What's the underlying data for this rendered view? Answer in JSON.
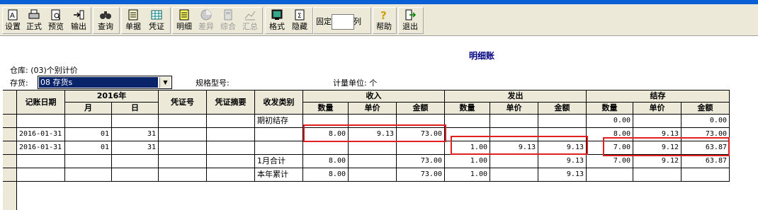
{
  "toolbar": {
    "buttons": [
      {
        "label": "设置",
        "icon": "settings-icon"
      },
      {
        "label": "正式",
        "icon": "print-icon"
      },
      {
        "label": "预览",
        "icon": "preview-icon"
      },
      {
        "label": "输出",
        "icon": "export-icon"
      },
      {
        "label": "查询",
        "icon": "binoculars-icon"
      },
      {
        "label": "单据",
        "icon": "document-icon"
      },
      {
        "label": "凭证",
        "icon": "voucher-icon"
      },
      {
        "label": "明细",
        "icon": "detail-icon"
      },
      {
        "label": "差异",
        "icon": "difference-icon"
      },
      {
        "label": "综合",
        "icon": "composite-icon"
      },
      {
        "label": "汇总",
        "icon": "summary-icon"
      },
      {
        "label": "格式",
        "icon": "format-icon"
      },
      {
        "label": "隐藏",
        "icon": "hide-icon"
      },
      {
        "label": "帮助",
        "icon": "help-icon"
      },
      {
        "label": "退出",
        "icon": "exit-icon"
      }
    ],
    "fix_label": "固定",
    "fix_value": "",
    "col_label": "列"
  },
  "report": {
    "title": "明细账",
    "warehouse": "仓库: (03)个别计价",
    "inventory_label": "存货:",
    "inventory_value": "08 存货s",
    "spec_label": "规格型号:",
    "unit_label": "计量单位: 个"
  },
  "table": {
    "headers": {
      "date": "记账日期",
      "year": "2016年",
      "month": "月",
      "day": "日",
      "voucher_no": "凭证号",
      "voucher_summary": "凭证摘要",
      "type": "收发类别",
      "in": "收入",
      "out": "发出",
      "balance": "结存",
      "qty": "数量",
      "price": "单价",
      "amount": "金额"
    },
    "rows": [
      {
        "date": "",
        "month": "",
        "day": "",
        "vno": "",
        "vsum": "",
        "type": "期初结存",
        "in_q": "",
        "in_p": "",
        "in_a": "",
        "out_q": "",
        "out_p": "",
        "out_a": "",
        "b_q": "0.00",
        "b_p": "",
        "b_a": "0.00"
      },
      {
        "date": "2016-01-31",
        "month": "01",
        "day": "31",
        "vno": "",
        "vsum": "",
        "type": "",
        "in_q": "8.00",
        "in_p": "9.13",
        "in_a": "73.00",
        "out_q": "",
        "out_p": "",
        "out_a": "",
        "b_q": "8.00",
        "b_p": "9.13",
        "b_a": "73.00"
      },
      {
        "date": "2016-01-31",
        "month": "01",
        "day": "31",
        "vno": "",
        "vsum": "",
        "type": "",
        "in_q": "",
        "in_p": "",
        "in_a": "",
        "out_q": "1.00",
        "out_p": "9.13",
        "out_a": "9.13",
        "b_q": "7.00",
        "b_p": "9.12",
        "b_a": "63.87"
      },
      {
        "date": "",
        "month": "",
        "day": "",
        "vno": "",
        "vsum": "",
        "type": "1月合计",
        "in_q": "8.00",
        "in_p": "",
        "in_a": "73.00",
        "out_q": "1.00",
        "out_p": "",
        "out_a": "9.13",
        "b_q": "7.00",
        "b_p": "9.12",
        "b_a": "63.87"
      },
      {
        "date": "",
        "month": "",
        "day": "",
        "vno": "",
        "vsum": "",
        "type": "本年累计",
        "in_q": "8.00",
        "in_p": "",
        "in_a": "73.00",
        "out_q": "1.00",
        "out_p": "",
        "out_a": "9.13",
        "b_q": "",
        "b_p": "",
        "b_a": ""
      }
    ]
  },
  "colors": {
    "highlight": "#e02020",
    "header_bg": "#ece9d8",
    "selection": "#0a246a",
    "title": "#000080"
  }
}
